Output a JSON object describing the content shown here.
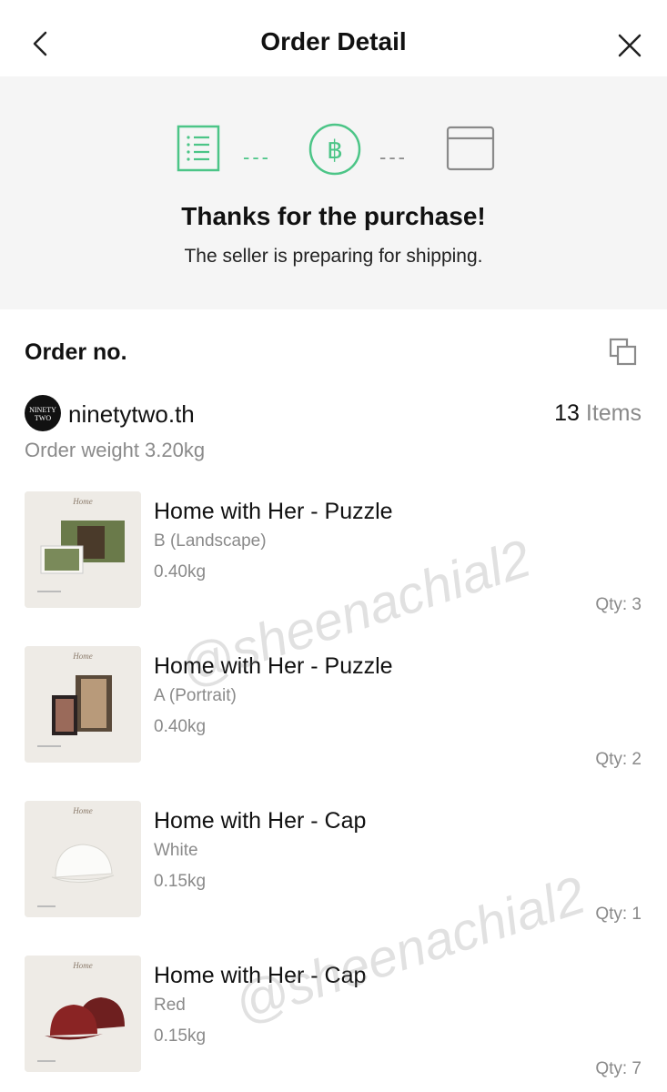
{
  "header": {
    "title": "Order Detail"
  },
  "status": {
    "title": "Thanks for the purchase!",
    "subtitle": "The seller is preparing for shipping.",
    "currency_symbol": "฿",
    "accent_color": "#4cc587",
    "inactive_color": "#8a8a8a",
    "steps": [
      "order-list-icon",
      "payment-baht-icon",
      "shipping-box-icon"
    ]
  },
  "order": {
    "order_no_label": "Order no.",
    "seller": {
      "name": "ninetytwo.th",
      "avatar_text": "NINETY TWO"
    },
    "items_count": "13",
    "items_word": "Items",
    "weight": "Order weight 3.20kg"
  },
  "products": [
    {
      "name": "Home with Her - Puzzle",
      "variant": "B (Landscape)",
      "weight": "0.40kg",
      "qty": "Qty: 3"
    },
    {
      "name": "Home with Her - Puzzle",
      "variant": "A (Portrait)",
      "weight": "0.40kg",
      "qty": "Qty: 2"
    },
    {
      "name": "Home with Her - Cap",
      "variant": "White",
      "weight": "0.15kg",
      "qty": "Qty: 1"
    },
    {
      "name": "Home with Her - Cap",
      "variant": "Red",
      "weight": "0.15kg",
      "qty": "Qty: 7"
    }
  ],
  "watermark": "@sheenachial2"
}
